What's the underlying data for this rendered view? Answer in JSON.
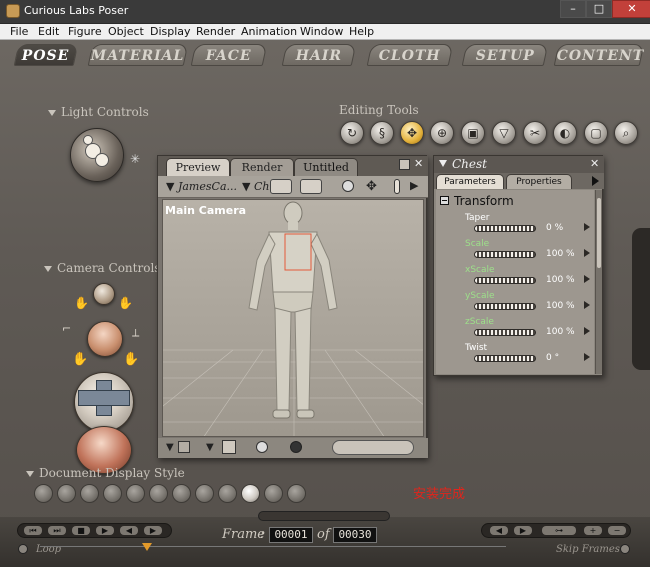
{
  "window": {
    "title": "Curious Labs Poser"
  },
  "titlebar_buttons": {
    "minimize": "–",
    "maximize": "□",
    "close": "✕"
  },
  "menu": [
    "File",
    "Edit",
    "Figure",
    "Object",
    "Display",
    "Render",
    "Animation",
    "Window",
    "Help"
  ],
  "rooms": {
    "active": "POSE",
    "items": [
      "POSE",
      "MATERIAL",
      "FACE",
      "HAIR",
      "CLOTH",
      "SETUP",
      "CONTENT"
    ]
  },
  "light_controls": {
    "label": "Light Controls"
  },
  "editing_tools": {
    "label": "Editing Tools",
    "selected": "translate-icon"
  },
  "camera_controls": {
    "label": "Camera Controls"
  },
  "document_display_style": {
    "label": "Document Display Style",
    "selected_index": 9
  },
  "preview": {
    "tabs": [
      "Preview",
      "Render",
      "Untitled"
    ],
    "active_tab": "Preview",
    "camera_select": "JamesCa...",
    "figure_select": "Ch",
    "viewport_label": "Main Camera"
  },
  "parameters": {
    "title": "Chest",
    "tabs": [
      "Parameters",
      "Properties"
    ],
    "active_tab": "Parameters",
    "group": "Transform",
    "params": [
      {
        "name": "Taper",
        "value": "0 %",
        "color": "white"
      },
      {
        "name": "Scale",
        "value": "100 %",
        "color": "green"
      },
      {
        "name": "xScale",
        "value": "100 %",
        "color": "green"
      },
      {
        "name": "yScale",
        "value": "100 %",
        "color": "green"
      },
      {
        "name": "zScale",
        "value": "100 %",
        "color": "green"
      },
      {
        "name": "Twist",
        "value": "0 °",
        "color": "white"
      }
    ]
  },
  "overlay_text": "安装完成",
  "timeline": {
    "frame_label": "Frame",
    "current_frame": "00001",
    "of_label": "of",
    "total_frames": "00030",
    "loop_label": "Loop",
    "skip_frames_label": "Skip Frames"
  },
  "colors": {
    "accent": "#e3b13a",
    "overlay_text": "#e0251c"
  }
}
